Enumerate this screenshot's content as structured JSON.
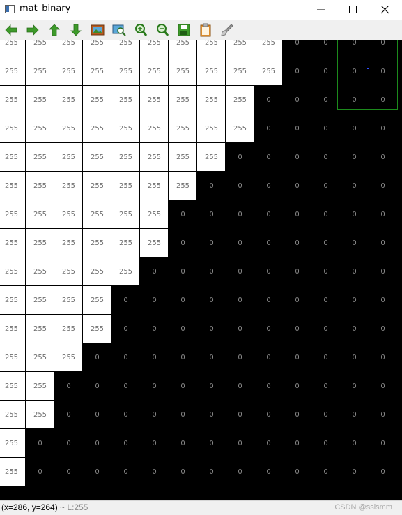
{
  "window": {
    "title": "mat_binary"
  },
  "titlebar_buttons": [
    {
      "name": "minimize",
      "icon": "minimize-icon"
    },
    {
      "name": "maximize",
      "icon": "maximize-icon"
    },
    {
      "name": "close",
      "icon": "close-icon"
    }
  ],
  "toolbar": {
    "buttons": [
      {
        "name": "panning-left",
        "icon": "arrow-left-icon"
      },
      {
        "name": "panning-right",
        "icon": "arrow-right-icon"
      },
      {
        "name": "panning-up",
        "icon": "arrow-up-icon"
      },
      {
        "name": "panning-down",
        "icon": "arrow-down-icon"
      },
      {
        "name": "zoom-image",
        "icon": "image-icon"
      },
      {
        "name": "zoom-original",
        "icon": "zoom-fit-icon"
      },
      {
        "name": "zoom-in",
        "icon": "zoom-in-icon"
      },
      {
        "name": "zoom-out",
        "icon": "zoom-out-icon"
      },
      {
        "name": "save",
        "icon": "save-icon"
      },
      {
        "name": "copy",
        "icon": "clipboard-icon"
      },
      {
        "name": "properties",
        "icon": "brush-icon"
      }
    ]
  },
  "pixel_grid": {
    "white_value": "255",
    "black_value": "0",
    "columns": 14,
    "white_counts_per_row": [
      10,
      10,
      9,
      9,
      8,
      7,
      6,
      6,
      5,
      4,
      4,
      3,
      2,
      2,
      1,
      1
    ]
  },
  "status": {
    "coords": "(x=286, y=264)",
    "separator": " ~ ",
    "value": "L:255"
  },
  "watermark": "CSDN @ssismm"
}
